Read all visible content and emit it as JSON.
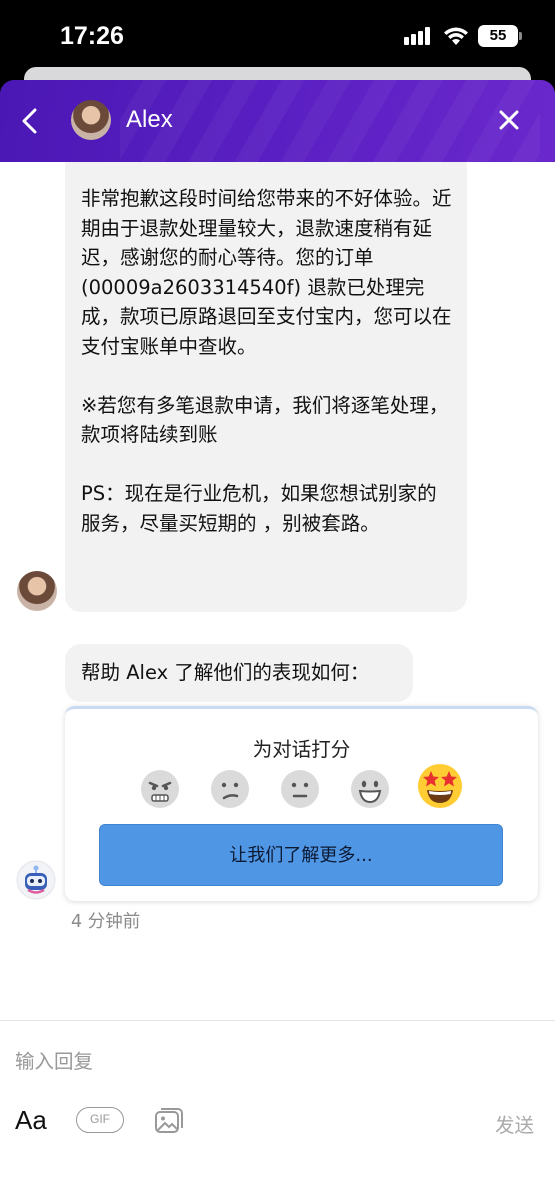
{
  "status_bar": {
    "time": "17:26",
    "battery": "55"
  },
  "header": {
    "contact_name": "Alex"
  },
  "message": {
    "paragraphs": [
      "非常抱歉这段时间给您带来的不好体验。近期由于退款处理量较大，退款速度稍有延迟，感谢您的耐心等待。您的订单 (00009a2603314540f) 退款已处理完成，款项已原路退回至支付宝内，您可以在支付宝账单中查收。",
      "※若您有多笔退款申请，我们将逐笔处理，款项将陆续到账",
      "PS：现在是行业危机，如果您想试别家的服务，尽量买短期的 ，别被套路。"
    ]
  },
  "rating": {
    "prompt": "帮助 Alex 了解他们的表现如何：",
    "title": "为对话打分",
    "button_label": "让我们了解更多...",
    "emojis": [
      "angry-face",
      "slightly-frowning-face",
      "neutral-face",
      "grinning-face",
      "star-struck-face"
    ],
    "selected": "star-struck-face"
  },
  "timestamp": "4 分钟前",
  "composer": {
    "placeholder": "输入回复",
    "text_format_label": "Aa",
    "gif_label": "GIF",
    "send_label": "发送"
  },
  "colors": {
    "header": "#5a1fc2",
    "button": "#4f96e5",
    "bubble": "#f2f2f3"
  }
}
